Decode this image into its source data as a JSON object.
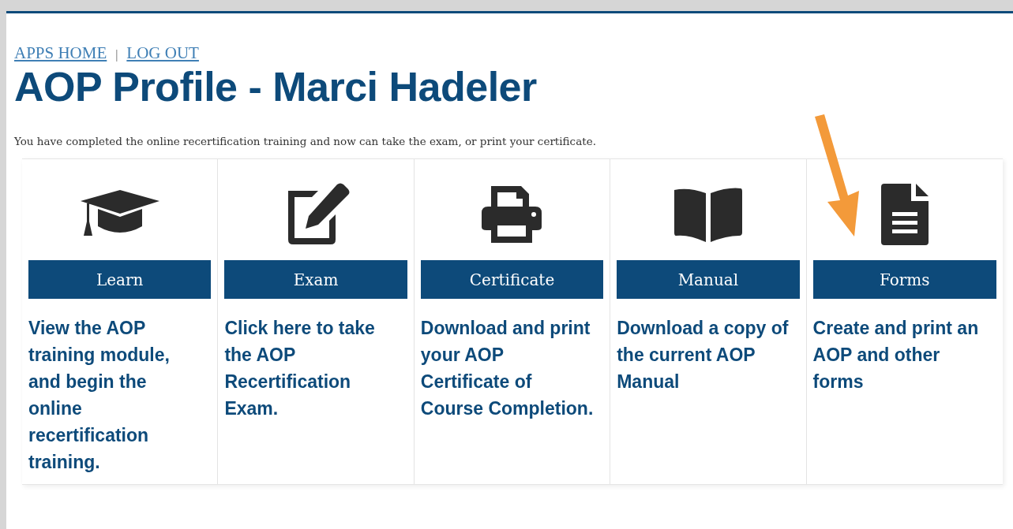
{
  "nav": [
    {
      "label": "APPS HOME"
    },
    {
      "label": "LOG OUT"
    }
  ],
  "separator": "|",
  "title": "AOP Profile - Marci Hadeler",
  "intro": "You have completed the online recertification training and now can take the exam, or print your certificate.",
  "cards": [
    {
      "button": "Learn",
      "description": "View the AOP training module, and begin the online recertification training."
    },
    {
      "button": "Exam",
      "description": "Click here to take the AOP Recertification Exam."
    },
    {
      "button": "Certificate",
      "description": "Download and print your AOP Certificate of Course Completion."
    },
    {
      "button": "Manual",
      "description": "Download a copy of the current AOP Manual"
    },
    {
      "button": "Forms",
      "description": "Create and print an AOP and other forms"
    }
  ]
}
